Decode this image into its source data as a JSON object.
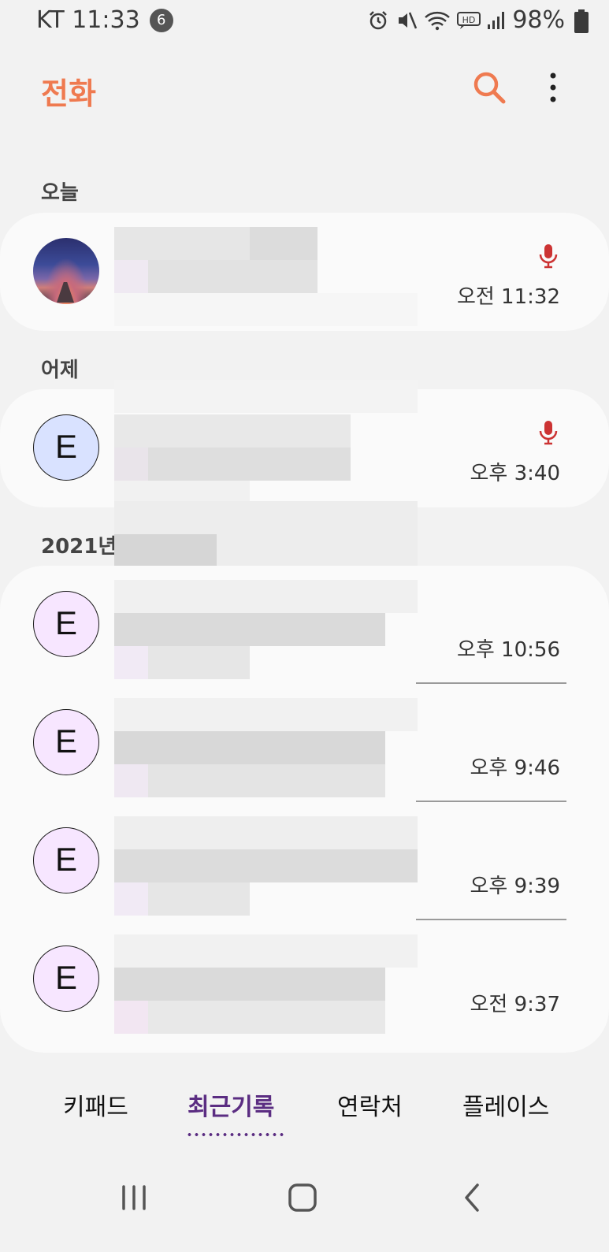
{
  "status_bar": {
    "carrier_time": "KT 11:33",
    "notification_count": "6",
    "battery": "98%",
    "icons": [
      "alarm-icon",
      "mute-icon",
      "wifi-icon",
      "hd-voice-icon",
      "signal-icon",
      "battery-icon"
    ]
  },
  "app_bar": {
    "title": "전화",
    "icons": [
      "search-icon",
      "more-options-icon"
    ]
  },
  "sections": [
    {
      "label": "오늘",
      "calls": [
        {
          "avatar": "",
          "avatar_type": "photo",
          "time": "오전 11:32",
          "recorded": true
        }
      ]
    },
    {
      "label": "어제",
      "calls": [
        {
          "avatar": "E",
          "avatar_type": "letter",
          "avatar_color": "#d9e2ff",
          "time": "오후 3:40",
          "recorded": true
        }
      ]
    },
    {
      "label": "2021년",
      "calls": [
        {
          "avatar": "E",
          "avatar_type": "letter",
          "avatar_color": "#f7e6ff",
          "time": "오후 10:56",
          "recorded": false
        },
        {
          "avatar": "E",
          "avatar_type": "letter",
          "avatar_color": "#f7e6ff",
          "time": "오후 9:46",
          "recorded": false
        },
        {
          "avatar": "E",
          "avatar_type": "letter",
          "avatar_color": "#f7e6ff",
          "time": "오후 9:39",
          "recorded": false
        },
        {
          "avatar": "E",
          "avatar_type": "letter",
          "avatar_color": "#f7e6ff",
          "time": "오전 9:37",
          "recorded": false
        }
      ]
    }
  ],
  "bottom_tabs": [
    {
      "label": "키패드",
      "active": false
    },
    {
      "label": "최근기록",
      "active": true
    },
    {
      "label": "연락처",
      "active": false
    },
    {
      "label": "플레이스",
      "active": false
    }
  ],
  "system_nav": [
    "recent-apps-icon",
    "home-icon",
    "back-icon"
  ],
  "colors": {
    "accent": "#ef7a50",
    "active_tab": "#5b2d82",
    "mic": "#cc3333",
    "background": "#f2f2f2",
    "card": "#fafafa"
  }
}
